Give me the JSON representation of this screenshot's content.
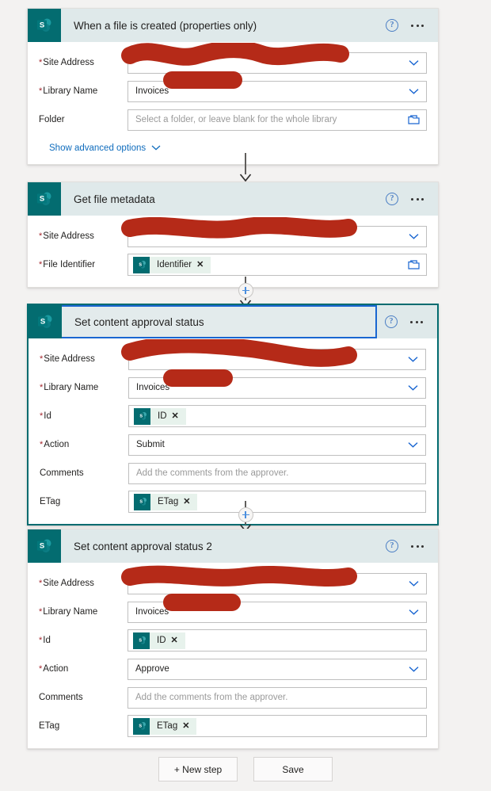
{
  "app": {
    "background_color": "#f3f2f1",
    "accent_color": "#036c70",
    "link_color": "#0f6cbd",
    "required_color": "#a4262c",
    "redaction_color": "#b52a18"
  },
  "cards": [
    {
      "title": "When a file is created (properties only)",
      "icon": "sharepoint-icon",
      "help_icon": "help-icon",
      "more_icon": "more-options-icon",
      "selected": false,
      "fields": [
        {
          "label": "Site Address",
          "required": true,
          "type": "dropdown",
          "value": "",
          "redacted": true
        },
        {
          "label": "Library Name",
          "required": true,
          "type": "dropdown",
          "value": "Invoices",
          "redacted": true
        },
        {
          "label": "Folder",
          "required": false,
          "type": "picker",
          "value": "",
          "placeholder": "Select a folder, or leave blank for the whole library",
          "redacted": false
        }
      ],
      "advanced_label": "Show advanced options"
    },
    {
      "title": "Get file metadata",
      "icon": "sharepoint-icon",
      "help_icon": "help-icon",
      "more_icon": "more-options-icon",
      "selected": false,
      "fields": [
        {
          "label": "Site Address",
          "required": true,
          "type": "dropdown",
          "value": "",
          "redacted": true
        },
        {
          "label": "File Identifier",
          "required": true,
          "type": "picker",
          "token": "Identifier",
          "redacted": false
        }
      ]
    },
    {
      "title": "Set content approval status",
      "icon": "sharepoint-icon",
      "help_icon": "help-icon",
      "more_icon": "more-options-icon",
      "selected": true,
      "fields": [
        {
          "label": "Site Address",
          "required": true,
          "type": "dropdown",
          "value": "",
          "redacted": true
        },
        {
          "label": "Library Name",
          "required": true,
          "type": "dropdown",
          "value": "Invoices",
          "redacted": true
        },
        {
          "label": "Id",
          "required": true,
          "type": "token",
          "token": "ID",
          "redacted": false
        },
        {
          "label": "Action",
          "required": true,
          "type": "dropdown",
          "value": "Submit",
          "redacted": false
        },
        {
          "label": "Comments",
          "required": false,
          "type": "text",
          "value": "",
          "placeholder": "Add the comments from the approver.",
          "redacted": false
        },
        {
          "label": "ETag",
          "required": false,
          "type": "token",
          "token": "ETag",
          "redacted": false
        }
      ]
    },
    {
      "title": "Set content approval status 2",
      "icon": "sharepoint-icon",
      "help_icon": "help-icon",
      "more_icon": "more-options-icon",
      "selected": false,
      "fields": [
        {
          "label": "Site Address",
          "required": true,
          "type": "dropdown",
          "value": "",
          "redacted": true
        },
        {
          "label": "Library Name",
          "required": true,
          "type": "dropdown",
          "value": "Invoices",
          "redacted": true
        },
        {
          "label": "Id",
          "required": true,
          "type": "token",
          "token": "ID",
          "redacted": false
        },
        {
          "label": "Action",
          "required": true,
          "type": "dropdown",
          "value": "Approve",
          "redacted": false
        },
        {
          "label": "Comments",
          "required": false,
          "type": "text",
          "value": "",
          "placeholder": "Add the comments from the approver.",
          "redacted": false
        },
        {
          "label": "ETag",
          "required": false,
          "type": "token",
          "token": "ETag",
          "redacted": false
        }
      ]
    }
  ],
  "connectors": [
    {
      "type": "arrow",
      "has_plus": false
    },
    {
      "type": "arrow",
      "has_plus": true
    },
    {
      "type": "arrow",
      "has_plus": true
    }
  ],
  "footer": {
    "new_step_label": "+ New step",
    "save_label": "Save"
  }
}
